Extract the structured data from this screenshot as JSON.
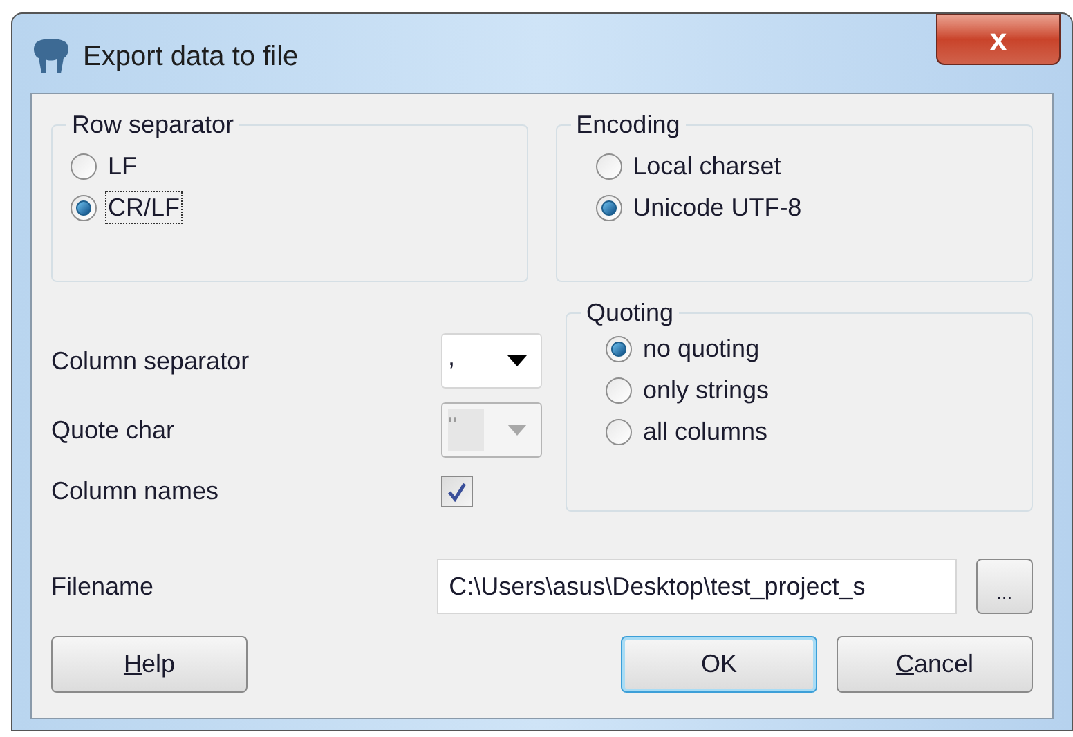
{
  "window": {
    "title": "Export data to file",
    "close_glyph": "x"
  },
  "row_separator": {
    "title": "Row separator",
    "options": [
      {
        "label": "LF",
        "selected": false,
        "focused": false
      },
      {
        "label": "CR/LF",
        "selected": true,
        "focused": true
      }
    ]
  },
  "encoding": {
    "title": "Encoding",
    "options": [
      {
        "label": "Local charset",
        "selected": false
      },
      {
        "label": "Unicode UTF-8",
        "selected": true
      }
    ]
  },
  "column_separator": {
    "label": "Column separator",
    "value": ",",
    "disabled": false
  },
  "quote_char": {
    "label": "Quote char",
    "value": "\"",
    "disabled": true
  },
  "column_names": {
    "label": "Column names",
    "checked": true
  },
  "quoting": {
    "title": "Quoting",
    "options": [
      {
        "label": "no quoting",
        "selected": true
      },
      {
        "label": "only strings",
        "selected": false
      },
      {
        "label": "all columns",
        "selected": false
      }
    ]
  },
  "filename": {
    "label": "Filename",
    "value": "C:\\Users\\asus\\Desktop\\test_project_s",
    "browse": "..."
  },
  "buttons": [
    {
      "label": "Help",
      "first_letter_underlined": true,
      "default": false
    },
    {
      "label": "OK",
      "first_letter_underlined": false,
      "default": true
    },
    {
      "label": "Cancel",
      "first_letter_underlined": true,
      "default": false
    }
  ]
}
